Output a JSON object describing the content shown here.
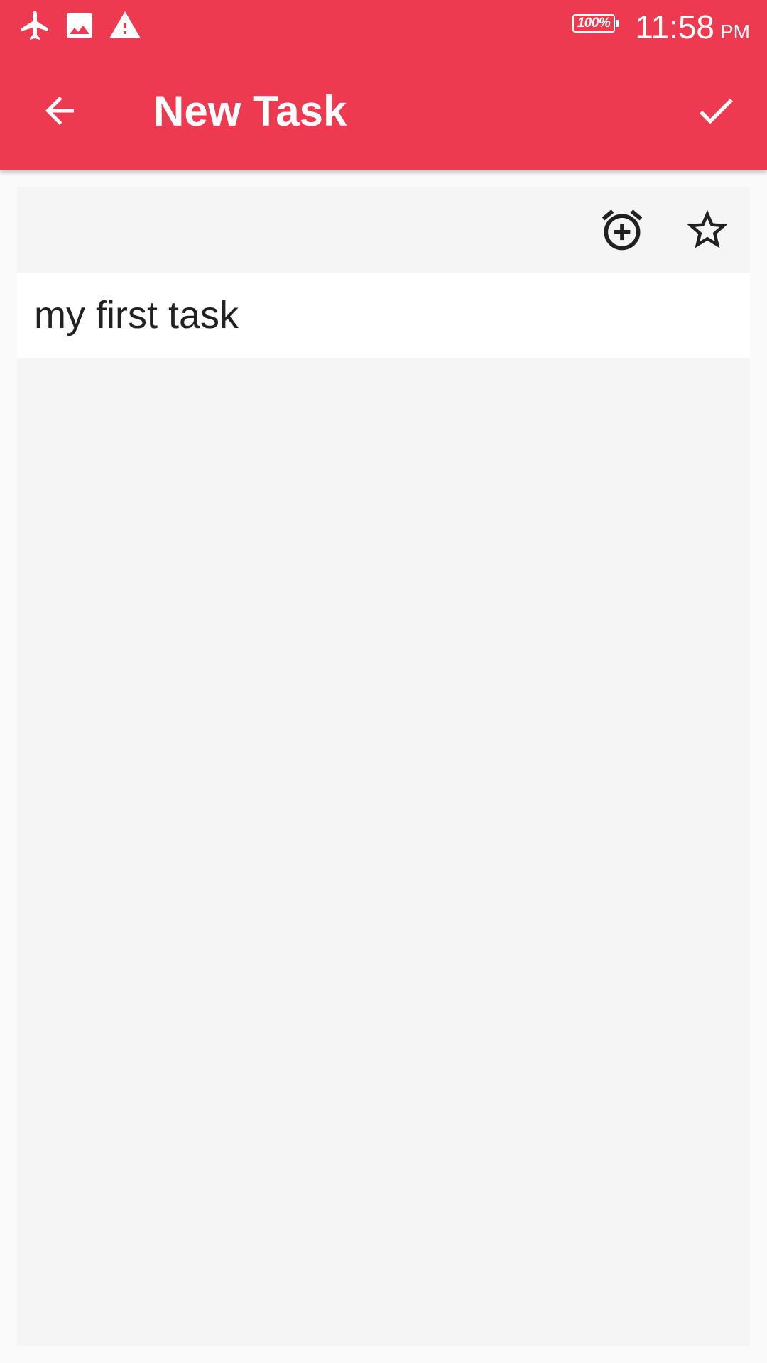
{
  "status_bar": {
    "icons": [
      "airplane-mode-icon",
      "image-icon",
      "warning-icon"
    ],
    "battery_level": "100%",
    "time": "11:58",
    "ampm": "PM"
  },
  "toolbar": {
    "back_icon": "arrow-back-icon",
    "title": "New Task",
    "save_icon": "check-icon"
  },
  "task": {
    "actions": [
      "alarm-add-icon",
      "star-outline-icon"
    ],
    "text": "my first task"
  },
  "colors": {
    "accent": "#ee3a51",
    "card_background": "#f5f5f5",
    "text": "#212121"
  }
}
